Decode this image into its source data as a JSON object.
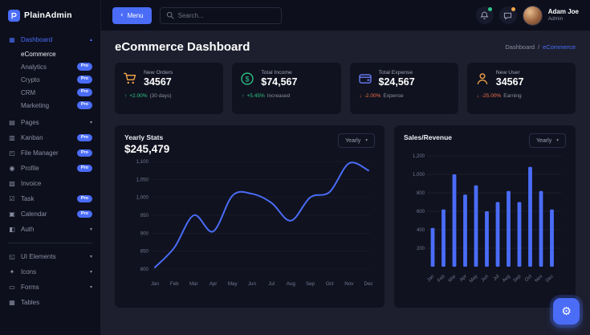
{
  "colors": {
    "accent": "#4a6cf7",
    "success": "#2dc98a",
    "danger": "#f4724c",
    "warning": "#f7a64a"
  },
  "icons": {
    "chevron_left": "‹",
    "chevron_down": "▾",
    "chevron_up": "▴",
    "gear": "⚙",
    "arrow_up": "↑",
    "arrow_down": "↓"
  },
  "glyphs": {
    "dashboard-icon": "▦",
    "pages-icon": "▤",
    "kanban-icon": "▥",
    "file-manager-icon": "◰",
    "profile-icon": "◉",
    "invoice-icon": "▧",
    "task-icon": "☑",
    "calendar-icon": "▣",
    "auth-icon": "◧",
    "ui-elements-icon": "◱",
    "icons-icon": "✦",
    "forms-icon": "▭",
    "tables-icon": "▦"
  },
  "sidebar": {
    "logo_text": "PlainAdmin",
    "dashboard": {
      "label": "Dashboard",
      "icon": "dashboard-icon",
      "chevron": "up",
      "active": true
    },
    "dashboard_children": [
      {
        "label": "eCommerce",
        "active": true
      },
      {
        "label": "Analytics",
        "badge": "Pro"
      },
      {
        "label": "Crypto",
        "badge": "Pro"
      },
      {
        "label": "CRM",
        "badge": "Pro"
      },
      {
        "label": "Marketing",
        "badge": "Pro"
      }
    ],
    "menu": [
      {
        "label": "Pages",
        "icon": "pages-icon",
        "chevron": "down"
      },
      {
        "label": "Kanban",
        "icon": "kanban-icon",
        "badge": "Pro"
      },
      {
        "label": "File Manager",
        "icon": "file-manager-icon",
        "badge": "Pro"
      },
      {
        "label": "Profile",
        "icon": "profile-icon",
        "badge": "Pro"
      },
      {
        "label": "Invoice",
        "icon": "invoice-icon"
      },
      {
        "label": "Task",
        "icon": "task-icon",
        "badge": "Pro"
      },
      {
        "label": "Calendar",
        "icon": "calendar-icon",
        "badge": "Pro"
      },
      {
        "label": "Auth",
        "icon": "auth-icon",
        "chevron": "down"
      }
    ],
    "menu_secondary": [
      {
        "label": "UI Elements",
        "icon": "ui-elements-icon",
        "chevron": "down"
      },
      {
        "label": "Icons",
        "icon": "icons-icon",
        "chevron": "down"
      },
      {
        "label": "Forms",
        "icon": "forms-icon",
        "chevron": "down"
      },
      {
        "label": "Tables",
        "icon": "tables-icon"
      }
    ]
  },
  "header": {
    "menu_button_label": "Menu",
    "search_placeholder": "Search...",
    "user_name": "Adam Joe",
    "user_role": "Admin"
  },
  "page": {
    "title": "eCommerce Dashboard",
    "breadcrumb_parent": "Dashboard",
    "breadcrumb_separator": "/",
    "breadcrumb_current": "eCommerce"
  },
  "stats": [
    {
      "title": "New Orders",
      "value": "34567",
      "direction": "up",
      "change": "+2.00%",
      "note": "(30 days)",
      "icon": "cart-icon",
      "color": "#f7a64a"
    },
    {
      "title": "Total Income",
      "value": "$74,567",
      "direction": "up",
      "change": "+5.45%",
      "note": "Increased",
      "icon": "dollar-icon",
      "color": "#2dc98a"
    },
    {
      "title": "Total Expense",
      "value": "$24,567",
      "direction": "down",
      "change": "-2.00%",
      "note": "Expense",
      "icon": "wallet-icon",
      "color": "#6a7ef9"
    },
    {
      "title": "New User",
      "value": "34567",
      "direction": "down",
      "change": "-25.00%",
      "note": "Earning",
      "icon": "user-icon",
      "color": "#f7a64a"
    }
  ],
  "panels": {
    "yearly_stats": {
      "title": "Yearly Stats",
      "total": "$245,479",
      "filter": "Yearly"
    },
    "sales_revenue": {
      "title": "Sales/Revenue",
      "filter": "Yearly"
    }
  },
  "chart_data": [
    {
      "type": "line",
      "title": "Yearly Stats",
      "x": [
        "Jan",
        "Feb",
        "Mar",
        "Apr",
        "May",
        "Jun",
        "Jul",
        "Aug",
        "Sep",
        "Oct",
        "Nov",
        "Dec"
      ],
      "values": [
        805,
        860,
        950,
        905,
        1005,
        1010,
        985,
        935,
        1000,
        1015,
        1095,
        1075
      ],
      "ylim": [
        800,
        1100
      ],
      "yticks": [
        800,
        850,
        900,
        950,
        1000,
        1050,
        1100
      ],
      "color": "#4a6cf7",
      "grid": false,
      "legend": false
    },
    {
      "type": "bar",
      "title": "Sales/Revenue",
      "categories": [
        "Jan",
        "Feb",
        "Mar",
        "Apr",
        "May",
        "Jun",
        "Jul",
        "Aug",
        "Sep",
        "Oct",
        "Nov",
        "Dec"
      ],
      "values": [
        420,
        620,
        1000,
        780,
        880,
        600,
        700,
        820,
        700,
        1080,
        820,
        620
      ],
      "ylim": [
        0,
        1200
      ],
      "yticks": [
        200,
        400,
        600,
        800,
        1000,
        1200
      ],
      "color": "#4a6cf7",
      "grid": true,
      "legend": false
    }
  ],
  "fab": {
    "label": "settings"
  }
}
